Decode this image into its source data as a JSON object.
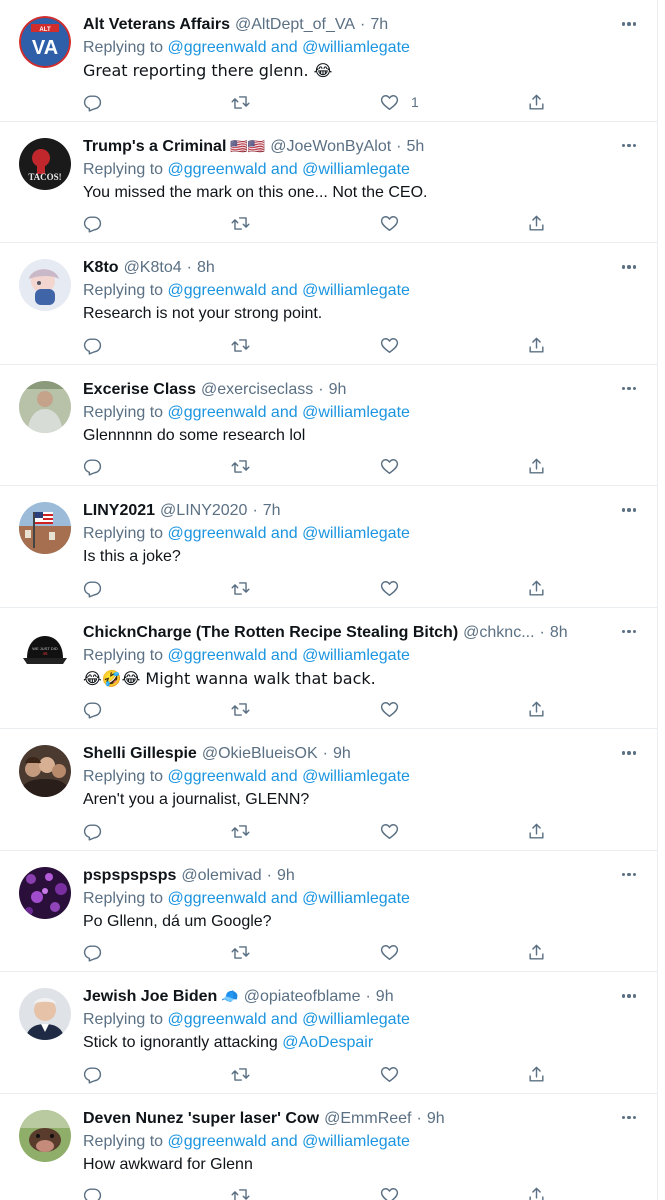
{
  "tweets": [
    {
      "name": "Alt Veterans Affairs",
      "flags": "",
      "handle": "@AltDept_of_VA",
      "time": "7h",
      "reply_prefix": "Replying to",
      "mention1": "@ggreenwald",
      "and": "and",
      "mention2": "@williamlegate",
      "text": "Great reporting there glenn. 😂",
      "text_link": "",
      "likes": "1",
      "avatar": "va-logo-avatar"
    },
    {
      "name": "Trump's a Criminal",
      "flags": "🇺🇸🇺🇸",
      "handle": "@JoeWonByAlot",
      "time": "5h",
      "reply_prefix": "Replying to",
      "mention1": "@ggreenwald",
      "and": "and",
      "mention2": "@williamlegate",
      "text": "You missed the mark on this one... Not the CEO.",
      "text_link": "",
      "likes": "",
      "avatar": "tacos-avatar"
    },
    {
      "name": "K8to",
      "flags": "",
      "handle": "@K8to4",
      "time": "8h",
      "reply_prefix": "Replying to",
      "mention1": "@ggreenwald",
      "and": "and",
      "mention2": "@williamlegate",
      "text": "Research is not your strong point.",
      "text_link": "",
      "likes": "",
      "avatar": "anime-avatar"
    },
    {
      "name": "Excerise Class",
      "flags": "",
      "handle": "@exerciseclass",
      "time": "9h",
      "reply_prefix": "Replying to",
      "mention1": "@ggreenwald",
      "and": "and",
      "mention2": "@williamlegate",
      "text": "Glennnnn do some research lol",
      "text_link": "",
      "likes": "",
      "avatar": "person-avatar"
    },
    {
      "name": "LINY2021",
      "flags": "",
      "handle": "@LINY2020",
      "time": "7h",
      "reply_prefix": "Replying to",
      "mention1": "@ggreenwald",
      "and": "and",
      "mention2": "@williamlegate",
      "text": "Is this a joke?",
      "text_link": "",
      "likes": "",
      "avatar": "flag-house-avatar"
    },
    {
      "name": "ChicknCharge (The Rotten Recipe Stealing Bitch)",
      "flags": "",
      "handle": "@chknc...",
      "time": "8h",
      "reply_prefix": "Replying to",
      "mention1": "@ggreenwald",
      "and": "and",
      "mention2": "@williamlegate",
      "text": "😂🤣😂 Might wanna walk that back.",
      "text_link": "",
      "likes": "",
      "avatar": "hat-avatar"
    },
    {
      "name": "Shelli Gillespie",
      "flags": "",
      "handle": "@OkieBlueisOK",
      "time": "9h",
      "reply_prefix": "Replying to",
      "mention1": "@ggreenwald",
      "and": "and",
      "mention2": "@williamlegate",
      "text": "Aren't you a journalist, GLENN?",
      "text_link": "",
      "likes": "",
      "avatar": "group-photo-avatar"
    },
    {
      "name": "pspspspsps",
      "flags": "",
      "handle": "@olemivad",
      "time": "9h",
      "reply_prefix": "Replying to",
      "mention1": "@ggreenwald",
      "and": "and",
      "mention2": "@williamlegate",
      "text": "Po Gllenn, dá um Google?",
      "text_link": "",
      "likes": "",
      "avatar": "purple-pattern-avatar"
    },
    {
      "name": "Jewish Joe Biden",
      "flags": "🧢",
      "handle": "@opiateofblame",
      "time": "9h",
      "reply_prefix": "Replying to",
      "mention1": "@ggreenwald",
      "and": "and",
      "mention2": "@williamlegate",
      "text": "Stick to ignorantly attacking ",
      "text_link": "@AoDespair",
      "likes": "",
      "avatar": "man-avatar"
    },
    {
      "name": "Deven Nunez 'super laser' Cow",
      "flags": "",
      "handle": "@EmmReef",
      "time": "9h",
      "reply_prefix": "Replying to",
      "mention1": "@ggreenwald",
      "and": "and",
      "mention2": "@williamlegate",
      "text": "How awkward for Glenn",
      "text_link": "",
      "likes": "",
      "avatar": "cow-avatar"
    }
  ],
  "colors": {
    "accent": "#1b95e0",
    "secondary_text": "#5b7083",
    "divider": "#ebeef0"
  },
  "icons": {
    "reply": "reply-icon",
    "retweet": "retweet-icon",
    "like": "heart-icon",
    "share": "share-icon",
    "more": "more-icon"
  }
}
